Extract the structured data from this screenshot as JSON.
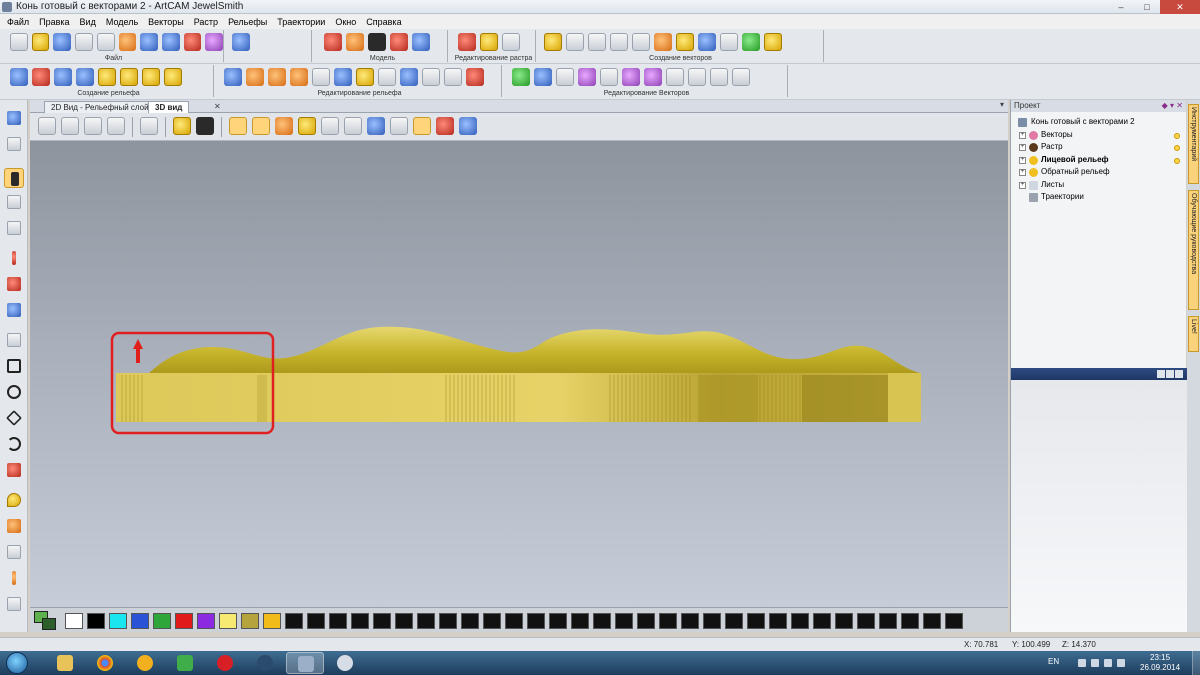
{
  "window": {
    "title": "Конь готовый с векторами 2 - ArtCAM JewelSmith"
  },
  "menu": [
    "Файл",
    "Правка",
    "Вид",
    "Модель",
    "Векторы",
    "Растр",
    "Рельефы",
    "Траектории",
    "Окно",
    "Справка"
  ],
  "toolbar_groups": {
    "file": "Файл",
    "model": "Модель",
    "raster_edit": "Редактирование растра",
    "vector_create": "Создание векторов",
    "relief_create": "Создание рельефа",
    "relief_edit": "Редактирование рельефа",
    "vector_edit": "Редактирование Векторов"
  },
  "view_tabs": [
    "2D Вид - Рельефный слой",
    "3D вид"
  ],
  "active_tab": "3D вид",
  "project": {
    "header": "Проект",
    "root": "Конь готовый с векторами 2",
    "nodes": [
      "Векторы",
      "Растр",
      "Лицевой рельеф",
      "Обратный рельеф",
      "Листы",
      "Траектории"
    ],
    "bold_node": "Лицевой рельеф"
  },
  "side_tabs": [
    "Инструментарий",
    "Обучающие руководства",
    "Live!"
  ],
  "palette": [
    "#ffffff",
    "#000000",
    "#19e6ef",
    "#2a52d6",
    "#2fa63a",
    "#e01a1a",
    "#8b2ae0",
    "#f7ea72",
    "#b5a43e",
    "#f1bb1a"
  ],
  "status": {
    "x": "X: 70.781",
    "y": "Y: 100.499",
    "z": "Z: 14.370"
  },
  "taskbar": {
    "lang": "EN",
    "time": "23:15",
    "date": "26.09.2014"
  },
  "colors": {
    "relief": "#d8c648",
    "highlight_box": "#e02020",
    "arrow": "#e0201a"
  }
}
